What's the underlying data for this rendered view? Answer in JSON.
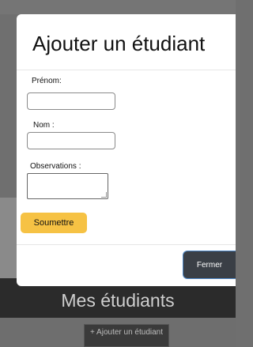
{
  "background": {
    "page_title": "Mes étudiants",
    "add_button_label": "+ Ajouter un étudiant"
  },
  "modal": {
    "title": "Ajouter un étudiant",
    "fields": {
      "firstname_label": "Prénom:",
      "firstname_value": "",
      "lastname_label": "Nom :",
      "lastname_value": "",
      "observations_label": "Observations :",
      "observations_value": ""
    },
    "submit_label": "Soumettre",
    "close_label": "Fermer"
  },
  "colors": {
    "submit_button": "#f6c244",
    "close_button": "#3a3f46",
    "header_bar": "#2b2b2b"
  }
}
